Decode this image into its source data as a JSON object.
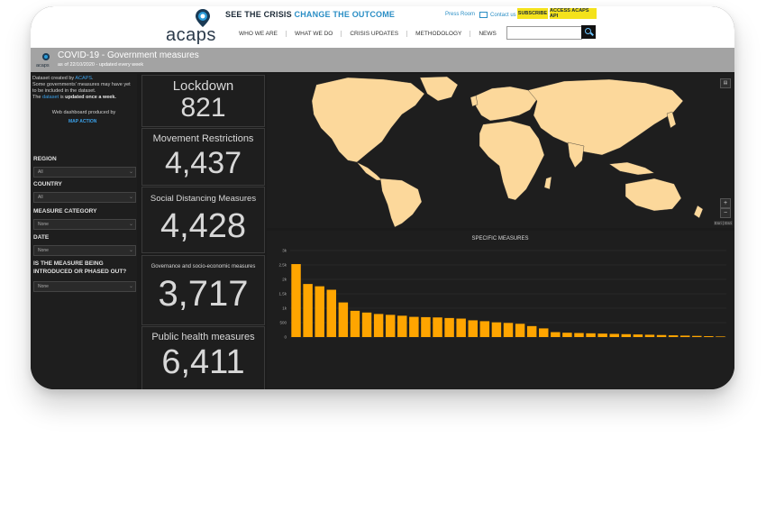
{
  "colors": {
    "accent": "#f4e21b",
    "link": "#2a8ec5",
    "bar": "#ffa500",
    "land": "#fcd89b",
    "ocean": "#1e1e1e"
  },
  "nav": {
    "logo": "acaps",
    "tagline_prefix": "SEE THE CRISIS",
    "tagline_highlight": "CHANGE THE OUTCOME",
    "press_room": "Press Room",
    "contact_us": "Contact us",
    "subscribe": "SUBSCRIBE",
    "access_api": "ACCESS ACAPS API",
    "menu": [
      "WHO WE ARE",
      "WHAT WE DO",
      "CRISIS UPDATES",
      "METHODOLOGY",
      "NEWS"
    ],
    "search_placeholder": ""
  },
  "header": {
    "title": "COVID-19 - Government measures",
    "subtitle": "as of 22/10/2020 - updated every week"
  },
  "sidebar": {
    "dataset_prefix": "Dataset created by ",
    "dataset_link": "ACAPS",
    "note": "Some governments' measures may have yet to be included in the dataset.",
    "the": "The ",
    "dataset_word": "dataset",
    "is_updated": " is ",
    "updated_once": "updated once a week.",
    "web_dashboard": "Web dashboard produced by",
    "producer": "MAP ACTION",
    "filters": [
      {
        "label": "REGION",
        "value": "All"
      },
      {
        "label": "COUNTRY",
        "value": "All"
      },
      {
        "label": "MEASURE CATEGORY",
        "value": "None"
      },
      {
        "label": "DATE",
        "value": "None"
      },
      {
        "label": "IS THE MEASURE BEING INTRODUCED OR PHASED OUT?",
        "value": "None"
      }
    ]
  },
  "kpis": [
    {
      "title": "Lockdown",
      "value": "821"
    },
    {
      "title": "Movement Restrictions",
      "value": "4,437"
    },
    {
      "title": "Social Distancing Measures",
      "value": "4,428"
    },
    {
      "title": "Governance and socio-economic measures",
      "value": "3,717"
    },
    {
      "title": "Public health measures",
      "value": "6,411"
    }
  ],
  "map": {
    "zoom_in": "+",
    "zoom_out": "−",
    "attribution": "Esri | Esri"
  },
  "chart_data": {
    "type": "bar",
    "title": "SPECIFIC MEASURES",
    "ylim": [
      0,
      3000
    ],
    "yticks": [
      "0",
      "500",
      "1k",
      "1.5k",
      "2k",
      "2.5k",
      "3k"
    ],
    "values": [
      2530,
      1840,
      1760,
      1640,
      1200,
      910,
      850,
      800,
      770,
      740,
      700,
      690,
      680,
      660,
      640,
      580,
      550,
      510,
      490,
      460,
      380,
      300,
      170,
      150,
      140,
      130,
      120,
      110,
      100,
      90,
      80,
      70,
      60,
      50,
      40,
      30,
      20
    ],
    "grid": true
  }
}
